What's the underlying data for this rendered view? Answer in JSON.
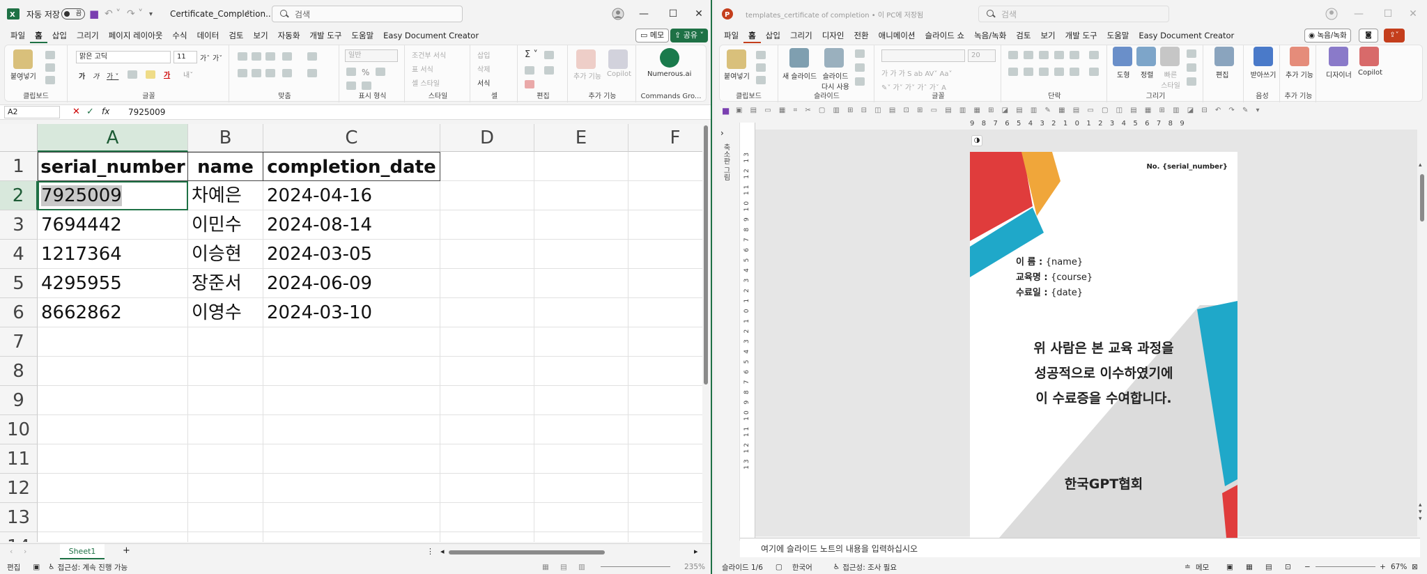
{
  "excel": {
    "autosave_label": "자동 저장",
    "autosave_state": "끔",
    "filename": "Certificate_Completion...",
    "search_placeholder": "검색",
    "tabs": [
      "파일",
      "홈",
      "삽입",
      "그리기",
      "페이지 레이아웃",
      "수식",
      "데이터",
      "검토",
      "보기",
      "자동화",
      "개발 도구",
      "도움말",
      "Easy Document Creator"
    ],
    "memo_label": "메모",
    "share_label": "공유",
    "ribbon": {
      "clipboard_label": "클립보드",
      "paste_label": "붙여넣기",
      "font_group_label": "글꼴",
      "font_name": "맑은 고딕",
      "font_size": "11",
      "align_group_label": "맞춤",
      "number_group_label": "표시 형식",
      "number_format": "일반",
      "style_group_label": "스타일",
      "style_items": [
        "조건부 서식",
        "표 서식",
        "셀 스타일"
      ],
      "cells_group_label": "셀",
      "cells_items": [
        "삽입",
        "삭제",
        "서식"
      ],
      "edit_group_label": "편집",
      "addins_group_label": "추가 기능",
      "addins_button": "추가 기능",
      "copilot_label": "Copilot",
      "commands_group_label": "Commands Gro...",
      "numerous_label": "Numerous.ai"
    },
    "namebox": "A2",
    "formula": "7925009",
    "columns": [
      "A",
      "B",
      "C",
      "D",
      "E",
      "F"
    ],
    "rows": [
      "1",
      "2",
      "3",
      "4",
      "5",
      "6",
      "7",
      "8",
      "9",
      "10",
      "11",
      "12",
      "13",
      "14"
    ],
    "headers": [
      "serial_number",
      "name",
      "completion_date"
    ],
    "data": [
      [
        "7925009",
        "차예은",
        "2024-04-16"
      ],
      [
        "7694442",
        "이민수",
        "2024-08-14"
      ],
      [
        "1217364",
        "이승현",
        "2024-03-05"
      ],
      [
        "4295955",
        "장준서",
        "2024-06-09"
      ],
      [
        "8662862",
        "이영수",
        "2024-03-10"
      ]
    ],
    "sheet_tab": "Sheet1",
    "status_mode": "편집",
    "status_accessibility": "접근성: 계속 진행 가능",
    "zoom": "235%"
  },
  "ppt": {
    "title": "templates_certificate of completion • 이 PC에 저장됨",
    "search_placeholder": "검색",
    "tabs": [
      "파일",
      "홈",
      "삽입",
      "그리기",
      "디자인",
      "전환",
      "애니메이션",
      "슬라이드 쇼",
      "녹음/녹화",
      "검토",
      "보기",
      "개발 도구",
      "도움말",
      "Easy Document Creator"
    ],
    "record_label": "녹음/녹화",
    "ribbon": {
      "clipboard_label": "클립보드",
      "paste_label": "붙여넣기",
      "slides_group_label": "슬라이드",
      "new_slide_label": "새 슬라이드",
      "reuse_slide_label": "슬라이드 다시 사용",
      "font_group_label": "글꼴",
      "font_size": "20",
      "para_group_label": "단락",
      "drawing_group_label": "그리기",
      "shape_label": "도형",
      "arrange_label": "정렬",
      "quick_style_label": "빠른 스타일",
      "edit_label": "편집",
      "edit_group_label": "편집",
      "dictate_label": "받아쓰기",
      "voice_group_label": "음성",
      "addins_label": "추가 기능",
      "addins_group_label": "추가 기능",
      "designer_label": "디자이너",
      "copilot_label": "Copilot"
    },
    "ruler_h": "9 8 7 6 5 4 3 2 1 0 1 2 3 4 5 6 7 8 9",
    "ruler_v": "13 12 11 10 9 8 7 6 5 4 3 2 1 0 1 2 3 4 5 6 7 8 9 10 11 12 13",
    "thumb_label": "축소판 그림",
    "slide": {
      "serial": "No. {serial_number}",
      "name_label": "이  름 :",
      "name_value": "{name}",
      "course_label": "교육명 :",
      "course_value": "{course}",
      "date_label": "수료일 :",
      "date_value": "{date}",
      "body_lines": [
        "위 사람은 본 교육 과정을",
        "성공적으로 이수하였기에",
        "이 수료증을 수여합니다."
      ],
      "issuer": "한국GPT협회"
    },
    "notes_placeholder": "여기에 슬라이드 노트의 내용을 입력하십시오",
    "status_slide": "슬라이드 1/6",
    "status_lang": "한국어",
    "status_accessibility": "접근성: 조사 필요",
    "status_notes": "메모",
    "zoom": "67%"
  },
  "colors": {
    "excel_green": "#1e7145",
    "ppt_red": "#c43e1c",
    "slide_red": "#e03c3c",
    "slide_orange": "#f0a63a",
    "slide_blue": "#1fa8c9",
    "slide_gray": "#dcdcdc"
  }
}
